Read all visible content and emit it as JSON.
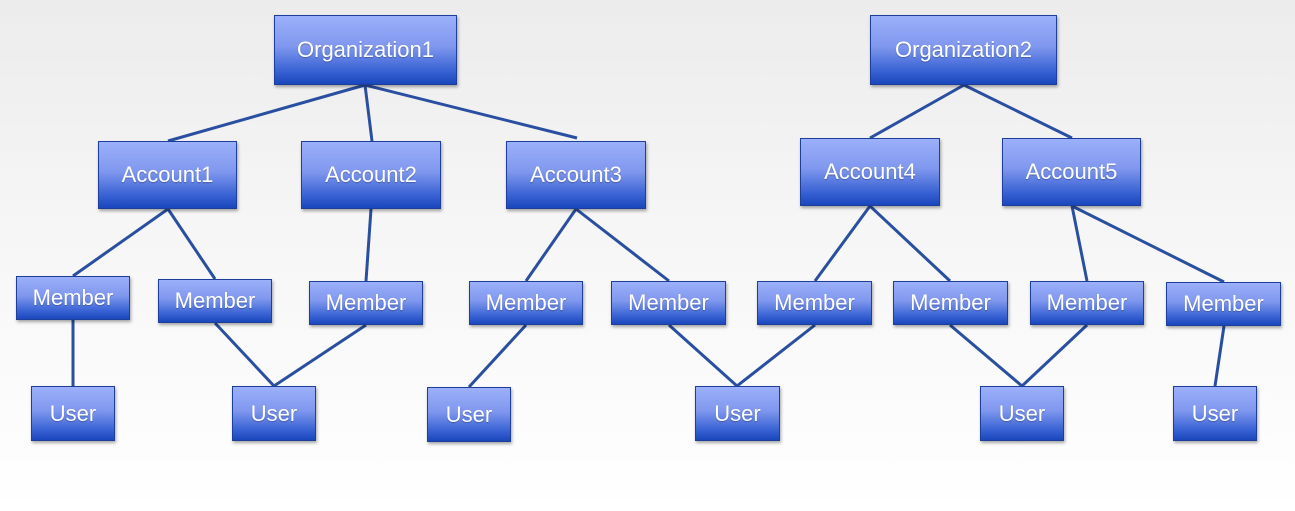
{
  "diagram": {
    "nodes": [
      {
        "id": "org1",
        "label": "Organization1"
      },
      {
        "id": "org2",
        "label": "Organization2"
      },
      {
        "id": "acc1",
        "label": "Account1"
      },
      {
        "id": "acc2",
        "label": "Account2"
      },
      {
        "id": "acc3",
        "label": "Account3"
      },
      {
        "id": "acc4",
        "label": "Account4"
      },
      {
        "id": "acc5",
        "label": "Account5"
      },
      {
        "id": "m1",
        "label": "Member"
      },
      {
        "id": "m2",
        "label": "Member"
      },
      {
        "id": "m3",
        "label": "Member"
      },
      {
        "id": "m4",
        "label": "Member"
      },
      {
        "id": "m5",
        "label": "Member"
      },
      {
        "id": "m6",
        "label": "Member"
      },
      {
        "id": "m7",
        "label": "Member"
      },
      {
        "id": "m8",
        "label": "Member"
      },
      {
        "id": "m9",
        "label": "Member"
      },
      {
        "id": "u1",
        "label": "User"
      },
      {
        "id": "u2",
        "label": "User"
      },
      {
        "id": "u3",
        "label": "User"
      },
      {
        "id": "u4",
        "label": "User"
      },
      {
        "id": "u5",
        "label": "User"
      },
      {
        "id": "u6",
        "label": "User"
      }
    ],
    "edges": [
      [
        "org1",
        "acc1"
      ],
      [
        "org1",
        "acc2"
      ],
      [
        "org1",
        "acc3"
      ],
      [
        "org2",
        "acc4"
      ],
      [
        "org2",
        "acc5"
      ],
      [
        "acc1",
        "m1"
      ],
      [
        "acc1",
        "m2"
      ],
      [
        "acc2",
        "m3"
      ],
      [
        "acc3",
        "m4"
      ],
      [
        "acc3",
        "m5"
      ],
      [
        "acc4",
        "m6"
      ],
      [
        "acc4",
        "m7"
      ],
      [
        "acc5",
        "m8"
      ],
      [
        "acc5",
        "m9"
      ],
      [
        "m1",
        "u1"
      ],
      [
        "m2",
        "u2"
      ],
      [
        "m3",
        "u2"
      ],
      [
        "m4",
        "u3"
      ],
      [
        "m5",
        "u4"
      ],
      [
        "m6",
        "u4"
      ],
      [
        "m7",
        "u5"
      ],
      [
        "m8",
        "u5"
      ],
      [
        "m9",
        "u6"
      ]
    ],
    "colors": {
      "node_top": "#9cb0fa",
      "node_bottom": "#1a47bd",
      "edge": "#2a4fa0",
      "text": "#ffffff"
    }
  }
}
